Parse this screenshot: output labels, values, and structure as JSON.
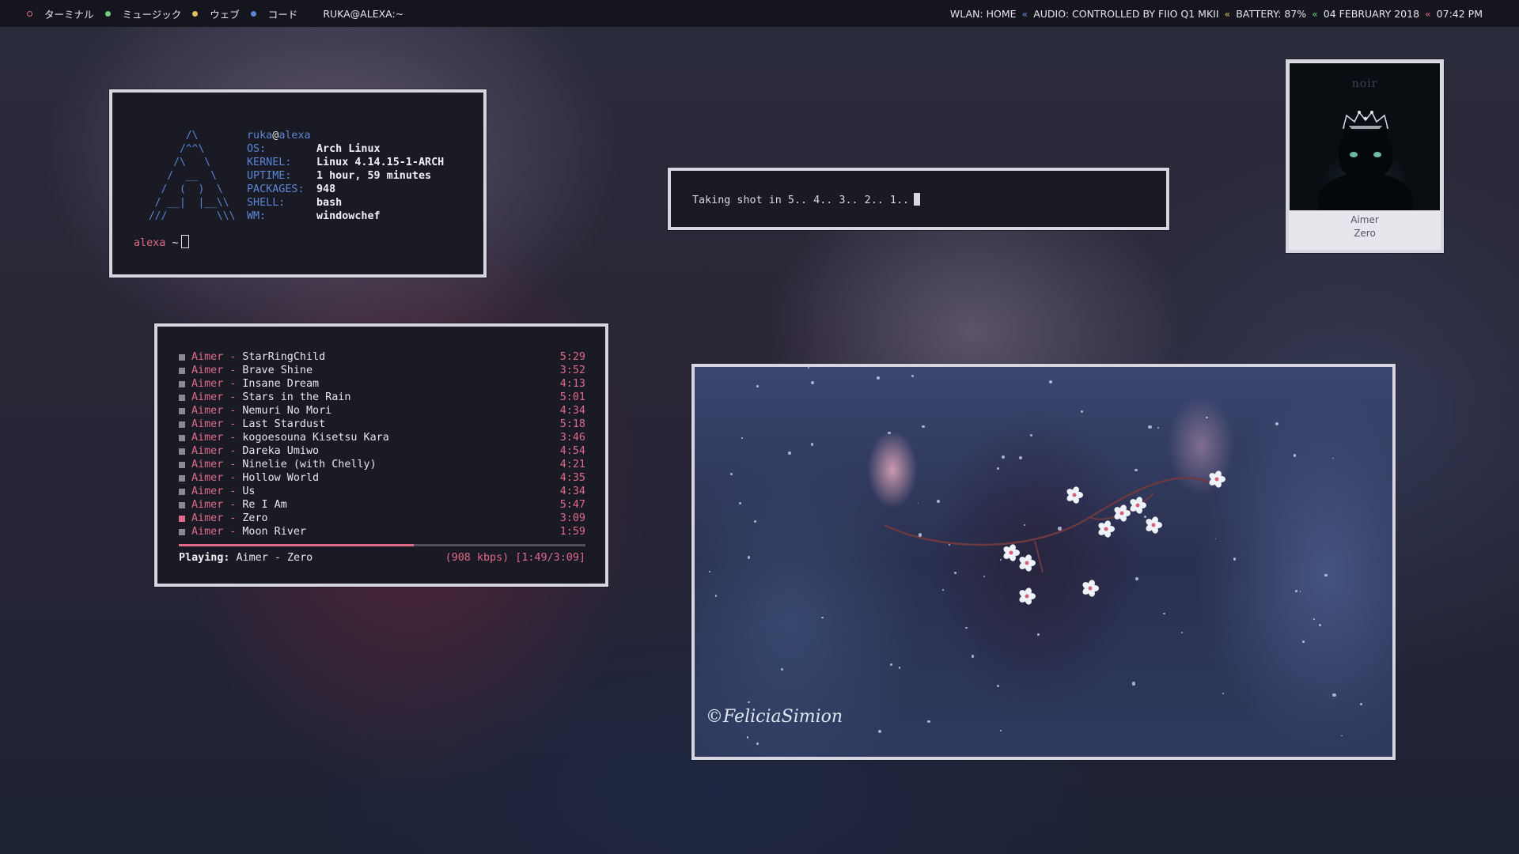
{
  "topbar": {
    "workspaces": [
      {
        "label": "ターミナル",
        "color": "#e06a8a",
        "style": "ring"
      },
      {
        "label": "ミュージック",
        "color": "#6fce7a",
        "style": "dot"
      },
      {
        "label": "ウェブ",
        "color": "#e0c060",
        "style": "dot"
      },
      {
        "label": "コード",
        "color": "#5b86d8",
        "style": "dot"
      }
    ],
    "window_title": "RUKA@ALEXA:~",
    "status": {
      "wlan": "WLAN: HOME",
      "audio": "AUDIO: CONTROLLED BY FIIO Q1 MKII",
      "battery": "BATTERY: 87%",
      "date": "04 FEBRUARY 2018",
      "time": "07:42 PM",
      "separator": "«"
    }
  },
  "neofetch": {
    "user": "ruka",
    "at": "@",
    "host": "alexa",
    "fields": [
      {
        "key": "OS:",
        "value": "Arch Linux"
      },
      {
        "key": "KERNEL:",
        "value": "Linux 4.14.15-1-ARCH"
      },
      {
        "key": "UPTIME:",
        "value": "1 hour, 59 minutes"
      },
      {
        "key": "PACKAGES:",
        "value": "948"
      },
      {
        "key": "SHELL:",
        "value": "bash"
      },
      {
        "key": "WM:",
        "value": "windowchef"
      }
    ],
    "prompt_host": "alexa",
    "prompt_path": "~"
  },
  "screenshot_term": {
    "text": "Taking shot in 5.. 4.. 3.. 2.. 1.."
  },
  "album": {
    "cover_text": "noir",
    "artist": "Aimer",
    "title": "Zero"
  },
  "player": {
    "tracks": [
      {
        "artist": "Aimer",
        "title": "StarRingChild",
        "duration": "5:29",
        "playing": false
      },
      {
        "artist": "Aimer",
        "title": "Brave Shine",
        "duration": "3:52",
        "playing": false
      },
      {
        "artist": "Aimer",
        "title": "Insane Dream",
        "duration": "4:13",
        "playing": false
      },
      {
        "artist": "Aimer",
        "title": "Stars in the Rain",
        "duration": "5:01",
        "playing": false
      },
      {
        "artist": "Aimer",
        "title": "Nemuri No Mori",
        "duration": "4:34",
        "playing": false
      },
      {
        "artist": "Aimer",
        "title": "Last Stardust",
        "duration": "5:18",
        "playing": false
      },
      {
        "artist": "Aimer",
        "title": "kogoesouna Kisetsu Kara",
        "duration": "3:46",
        "playing": false
      },
      {
        "artist": "Aimer",
        "title": "Dareka Umiwo",
        "duration": "4:54",
        "playing": false
      },
      {
        "artist": "Aimer",
        "title": "Ninelie (with Chelly)",
        "duration": "4:21",
        "playing": false
      },
      {
        "artist": "Aimer",
        "title": "Hollow World",
        "duration": "4:35",
        "playing": false
      },
      {
        "artist": "Aimer",
        "title": "Us",
        "duration": "4:34",
        "playing": false
      },
      {
        "artist": "Aimer",
        "title": "Re I Am",
        "duration": "5:47",
        "playing": false
      },
      {
        "artist": "Aimer",
        "title": "Zero",
        "duration": "3:09",
        "playing": true
      },
      {
        "artist": "Aimer",
        "title": "Moon River",
        "duration": "1:59",
        "playing": false
      }
    ],
    "progress_fraction": 0.577,
    "now_playing_label": "Playing:",
    "now_playing": "Aimer - Zero",
    "stream_info": "(908 kbps) [1:49/3:09]"
  },
  "viewer": {
    "signature": "©FeliciaSimion"
  },
  "colors": {
    "accent_pink": "#e06a8a",
    "accent_blue": "#5b86d8",
    "window_border": "#d7d5df",
    "window_bg": "#191a23"
  }
}
